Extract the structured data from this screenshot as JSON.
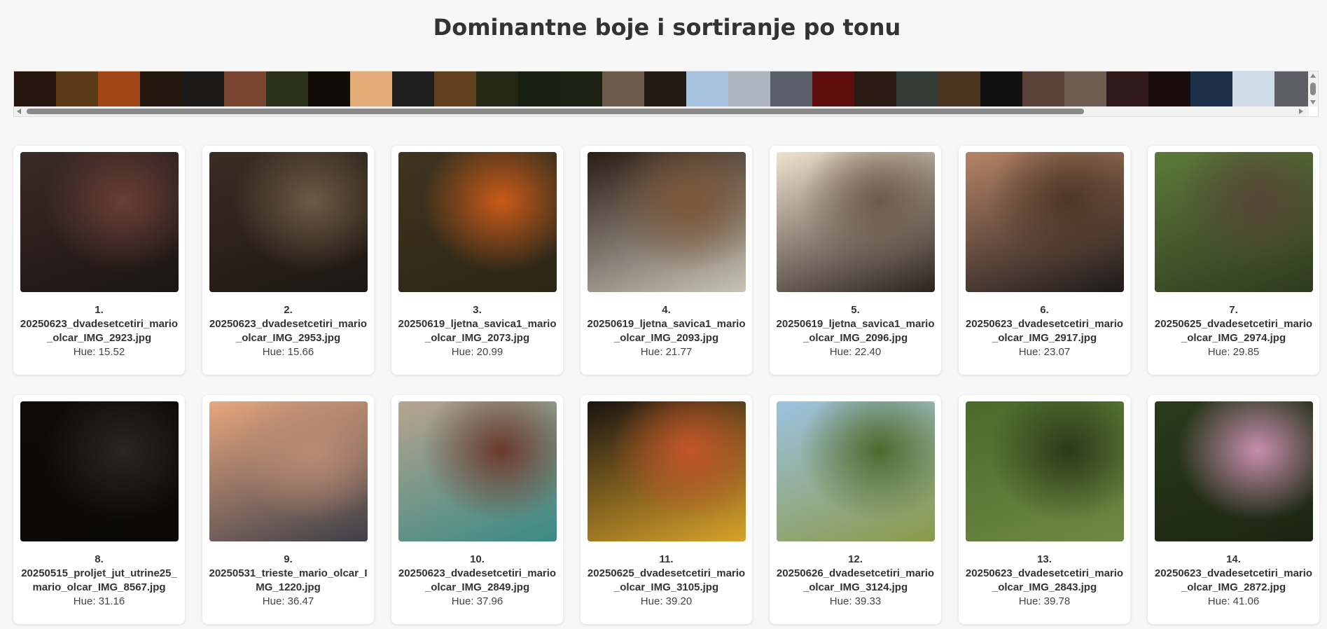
{
  "title": "Dominantne boje i sortiranje po tonu",
  "palette": [
    "#26150d",
    "#5a3a17",
    "#a14717",
    "#22170d",
    "#1c1a18",
    "#7a4631",
    "#2c311a",
    "#120c07",
    "#e2ab78",
    "#1f1f1f",
    "#5f3f1c",
    "#232714",
    "#172012",
    "#1b2211",
    "#6e5a48",
    "#231a14",
    "#a6c2dd",
    "#aeb7bf",
    "#5a6069",
    "#5c0d0b",
    "#2b1a12",
    "#333b36",
    "#4a3420",
    "#101010",
    "#5a4238",
    "#6f5d51",
    "#321a1a",
    "#190d0b",
    "#1c3049",
    "#cfdde8",
    "#5e5e66"
  ],
  "images": [
    {
      "index": "1.",
      "filename": "20250623_dvadesetcetiri_mario_olcar_IMG_2923.jpg",
      "hue": "Hue: 15.52",
      "colors": [
        "#3b2a25",
        "#6a3e35",
        "#1b1512"
      ]
    },
    {
      "index": "2.",
      "filename": "20250623_dvadesetcetiri_mario_olcar_IMG_2953.jpg",
      "hue": "Hue: 15.66",
      "colors": [
        "#3a2d22",
        "#6e5a44",
        "#1d1712"
      ]
    },
    {
      "index": "3.",
      "filename": "20250619_ljetna_savica1_mario_olcar_IMG_2073.jpg",
      "hue": "Hue: 20.99",
      "colors": [
        "#3e3420",
        "#c95a1a",
        "#2c2615"
      ]
    },
    {
      "index": "4.",
      "filename": "20250619_ljetna_savica1_mario_olcar_IMG_2093.jpg",
      "hue": "Hue: 21.77",
      "colors": [
        "#2a1d14",
        "#7d5636",
        "#c8c3b5"
      ]
    },
    {
      "index": "5.",
      "filename": "20250619_ljetna_savica1_mario_olcar_IMG_2096.jpg",
      "hue": "Hue: 22.40",
      "colors": [
        "#f0e1cf",
        "#6d5a4a",
        "#2c241d"
      ]
    },
    {
      "index": "6.",
      "filename": "20250623_dvadesetcetiri_mario_olcar_IMG_2917.jpg",
      "hue": "Hue: 23.07",
      "colors": [
        "#b58466",
        "#4f3725",
        "#1d1a1a"
      ]
    },
    {
      "index": "7.",
      "filename": "20250625_dvadesetcetiri_mario_olcar_IMG_2974.jpg",
      "hue": "Hue: 29.85",
      "colors": [
        "#5c7a3a",
        "#574636",
        "#2e3a1e"
      ]
    },
    {
      "index": "8.",
      "filename": "20250515_proljet_jut_utrine25_mario_olcar_IMG_8567.jpg",
      "hue": "Hue: 31.16",
      "colors": [
        "#0d0b09",
        "#2a2620",
        "#0a0908"
      ]
    },
    {
      "index": "9.",
      "filename": "20250531_trieste_mario_olcar_IMG_1220.jpg",
      "hue": "Hue: 36.47",
      "colors": [
        "#e7a77e",
        "#b98b73",
        "#3e3f48"
      ]
    },
    {
      "index": "10.",
      "filename": "20250623_dvadesetcetiri_mario_olcar_IMG_2849.jpg",
      "hue": "Hue: 37.96",
      "colors": [
        "#b7a48f",
        "#6b3a2c",
        "#3a8a84"
      ]
    },
    {
      "index": "11.",
      "filename": "20250625_dvadesetcetiri_mario_olcar_IMG_3105.jpg",
      "hue": "Hue: 39.20",
      "colors": [
        "#1a1410",
        "#c4552a",
        "#d9a32b"
      ]
    },
    {
      "index": "12.",
      "filename": "20250626_dvadesetcetiri_mario_olcar_IMG_3124.jpg",
      "hue": "Hue: 39.33",
      "colors": [
        "#9cc2e0",
        "#4d6a2e",
        "#8a9a4a"
      ]
    },
    {
      "index": "13.",
      "filename": "20250623_dvadesetcetiri_mario_olcar_IMG_2843.jpg",
      "hue": "Hue: 39.78",
      "colors": [
        "#4a6a2a",
        "#2a3a18",
        "#6e8a44"
      ]
    },
    {
      "index": "14.",
      "filename": "20250623_dvadesetcetiri_mario_olcar_IMG_2872.jpg",
      "hue": "Hue: 41.06",
      "colors": [
        "#2a3a1a",
        "#c88fb0",
        "#1b2612"
      ]
    }
  ]
}
